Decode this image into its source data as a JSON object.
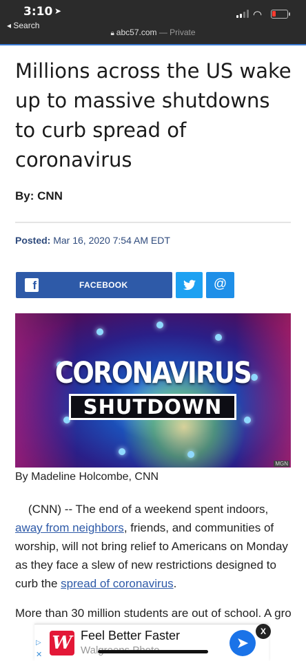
{
  "status": {
    "time": "3:10",
    "back_label": "◂ Search"
  },
  "browser": {
    "domain": "abc57.com",
    "mode": " — Private"
  },
  "article": {
    "headline": "Millions across the US wake up to massive shutdowns to curb spread of coronavirus",
    "byline": "By: CNN",
    "posted_label": "Posted:",
    "posted_value": "Mar 16, 2020 7:54 AM EDT",
    "image": {
      "title_line1": "CORONAVIRUS",
      "title_line2": "SHUTDOWN",
      "credit": "MGN"
    },
    "caption": "By Madeline Holcombe, CNN",
    "para1_pre": "(CNN) -- The end of a weekend spent indoors,",
    "para1_link1": "away from neighbors",
    "para1_mid": ", friends, and communities of worship, will not bring relief to Americans on Monday as they face a slew of new restrictions designed to curb the",
    "para1_link2": "spread of coronavirus",
    "para1_end": ".",
    "para2": "More than 30 million students are out of school. A gro"
  },
  "share": {
    "facebook_label": "FACEBOOK",
    "twitter_icon": "twitter-bird",
    "email_icon": "@"
  },
  "ad": {
    "title": "Feel Better Faster",
    "subtitle": "Walgreens Photo",
    "logo_letter": "W",
    "close": "X"
  },
  "colors": {
    "link": "#2e5aa8",
    "facebook": "#2e5aa8",
    "twitter": "#1da1f2",
    "ad_brand": "#e31837"
  }
}
